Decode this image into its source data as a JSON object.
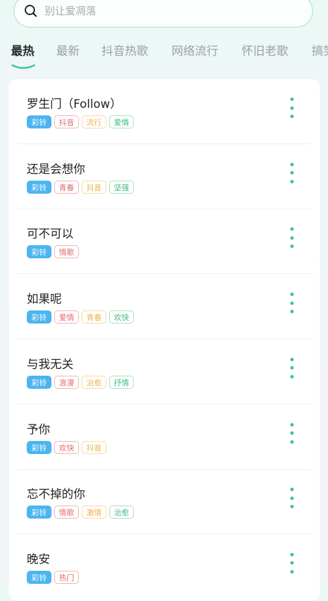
{
  "search": {
    "placeholder": "别让爱凋落"
  },
  "tabs": [
    {
      "label": "最热",
      "active": true
    },
    {
      "label": "最新",
      "active": false
    },
    {
      "label": "抖音热歌",
      "active": false
    },
    {
      "label": "网络流行",
      "active": false
    },
    {
      "label": "怀旧老歌",
      "active": false
    },
    {
      "label": "搞笑",
      "active": false
    }
  ],
  "songs": [
    {
      "title": "罗生门（Follow）",
      "tags": [
        "彩铃",
        "抖音",
        "流行",
        "爱情"
      ]
    },
    {
      "title": "还是会想你",
      "tags": [
        "彩铃",
        "青春",
        "抖音",
        "坚强"
      ]
    },
    {
      "title": "可不可以",
      "tags": [
        "彩铃",
        "情歌"
      ]
    },
    {
      "title": "如果呢",
      "tags": [
        "彩铃",
        "爱情",
        "青春",
        "欢快"
      ]
    },
    {
      "title": "与我无关",
      "tags": [
        "彩铃",
        "浪漫",
        "治愈",
        "抒情"
      ]
    },
    {
      "title": "予你",
      "tags": [
        "彩铃",
        "欢快",
        "抖音"
      ]
    },
    {
      "title": "忘不掉的你",
      "tags": [
        "彩铃",
        "情歌",
        "激情",
        "治愈"
      ]
    },
    {
      "title": "晚安",
      "tags": [
        "彩铃",
        "热门"
      ]
    }
  ],
  "colors": {
    "accent": "#3fc48c",
    "tag_primary": "#4cb4f0",
    "tag_red": "#e36b6b",
    "tag_orange": "#eeb048",
    "tag_green": "#3fba82"
  },
  "icons": {
    "search": "search-icon",
    "more": "more-vertical-icon"
  }
}
